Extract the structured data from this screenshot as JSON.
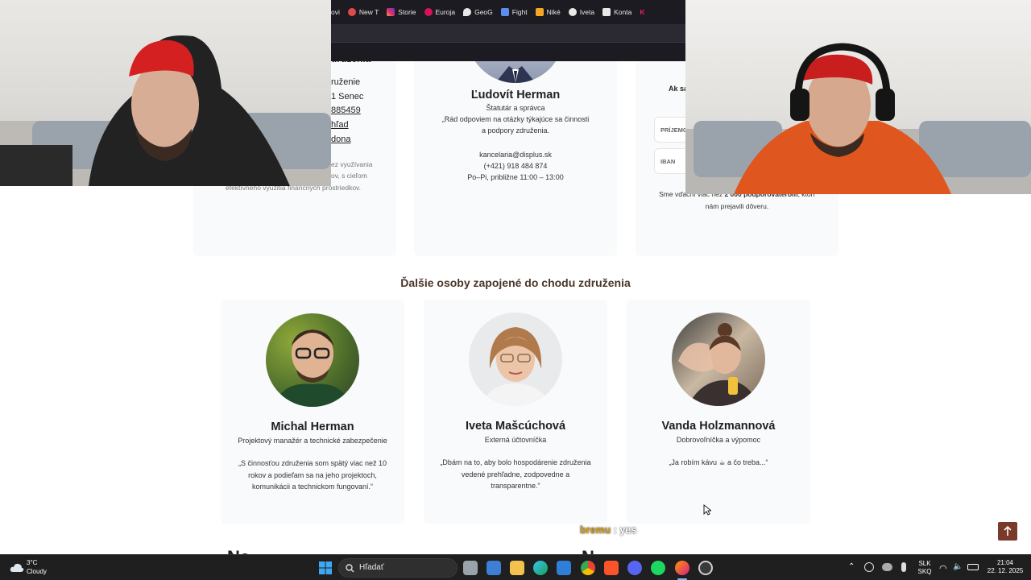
{
  "browser": {
    "bookmarks": [
      {
        "label": "ovi",
        "color": "#9aa0a6"
      },
      {
        "label": "New T",
        "color": "#e04a4a"
      },
      {
        "label": "Storie",
        "color": "#d62976"
      },
      {
        "label": "Euroja",
        "color": "#d4145a"
      },
      {
        "label": "GeoG",
        "color": "#e8e8e8"
      },
      {
        "label": "Fight",
        "color": "#5b8def"
      },
      {
        "label": "Niké",
        "color": "#f5a623"
      },
      {
        "label": "Iveta",
        "color": "#e8e8e8"
      },
      {
        "label": "Konta",
        "color": "#e8e8e8"
      },
      {
        "label": "K",
        "color": "#e0245e"
      }
    ]
  },
  "page": {
    "left_column": {
      "heading_fragment": "druženia",
      "links": [
        "ruženie",
        "1 Senec",
        "885459",
        "hľad",
        "dona"
      ],
      "text_fragment_lines": [
        "ez využívania",
        "ov, s cieľom",
        "efektívneho využitia finančných prostriedkov."
      ]
    },
    "center_person": {
      "name": "Ľudovít Herman",
      "role": "Štatutár a správca",
      "quote": "„Rád odpoviem na otázky týkajúce sa činnosti a podpory združenia.",
      "email": "kancelaria@displus.sk",
      "phone": "(+421) 918 484 874",
      "hours": "Po–Pi, približne 11:00 – 13:00"
    },
    "right_column": {
      "fragment_title": "Ak sa",
      "field_prijemca": "PRÍJEMC",
      "field_iban": "IBAN",
      "supporters_pre": "Sme vďační viac než ",
      "supporters_bold": "2 000 podporovateľom",
      "supporters_post": ", ktorí",
      "supporters_line2": "nám prejavili dôveru."
    },
    "section_title": "Ďalšie osoby zapojené do chodu združenia",
    "people": [
      {
        "name": "Michal Herman",
        "role": "Projektový manažér a technické zabezpečenie",
        "quote": "„S činnosťou združenia som spätý viac než 10 rokov a podieľam sa na jeho projektoch, komunikácii a technickom fungovaní.“"
      },
      {
        "name": "Iveta Mašcúchová",
        "role": "Externá účtovníčka",
        "quote": "„Dbám na to, aby bolo hospodárenie združenia vedené prehľadne, zodpovedne a transparentne.“"
      },
      {
        "name": "Vanda Holzmannová",
        "role": "Dobrovoľníčka a výpomoc",
        "quote": "„Ja robím kávu ☕ a čo treba...“"
      }
    ],
    "bottom_fragments": [
      "Ne...",
      "N..."
    ]
  },
  "chat": {
    "user": "bremu",
    "separator": " : ",
    "message": "yes",
    "user_color": "#d4a017"
  },
  "taskbar": {
    "weather_temp": "3°C",
    "weather_desc": "Cloudy",
    "search_label": "Hľadať",
    "language_1": "SLK",
    "language_2": "SKQ",
    "time": "21:04",
    "date": "22. 12. 2025"
  }
}
